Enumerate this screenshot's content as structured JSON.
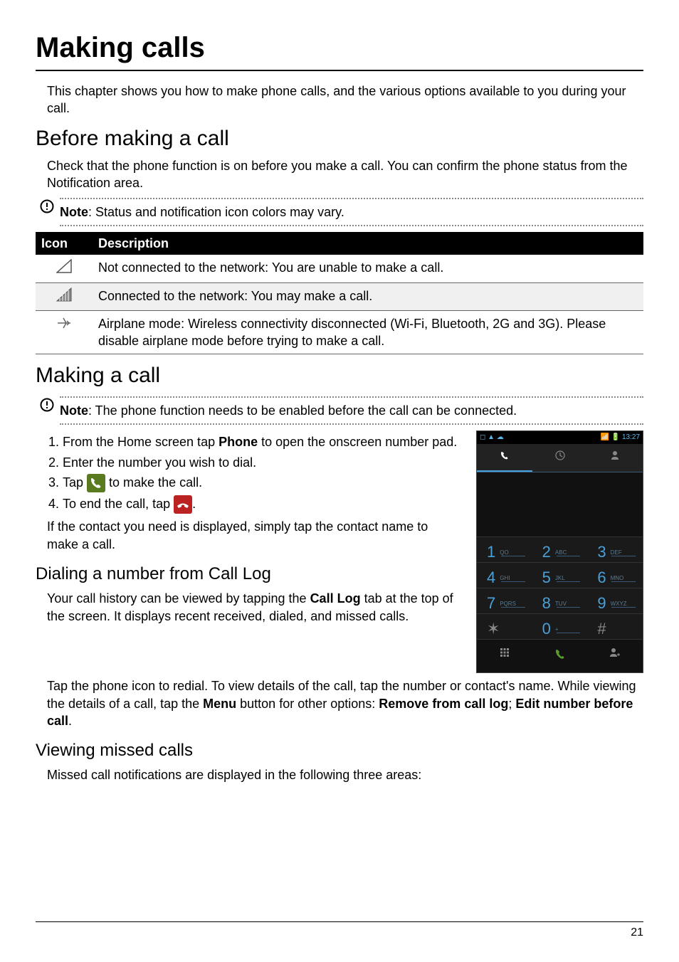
{
  "page": {
    "title": "Making calls",
    "intro": "This chapter shows you how to make phone calls, and the various options available to you during your call.",
    "number": "21"
  },
  "before": {
    "heading": "Before making a call",
    "text": "Check that the phone function is on before you make a call. You can confirm the phone status from the Notification area.",
    "note_label": "Note",
    "note_text": ": Status and notification icon colors may vary."
  },
  "table": {
    "col_icon": "Icon",
    "col_desc": "Description",
    "rows": [
      {
        "desc": "Not connected to the network: You are unable to make a call."
      },
      {
        "desc": "Connected to the network: You may make a call."
      },
      {
        "desc": "Airplane mode: Wireless connectivity disconnected (Wi-Fi, Bluetooth, 2G and 3G). Please disable airplane mode before trying to make a call."
      }
    ]
  },
  "making": {
    "heading": "Making a call",
    "note_label": "Note",
    "note_text": ": The phone function needs to be enabled before the call can be connected.",
    "step1_a": "From the Home screen tap ",
    "step1_b": "Phone",
    "step1_c": " to open the onscreen number pad.",
    "step2": "Enter the number you wish to dial.",
    "step3_a": "Tap ",
    "step3_b": " to make the call.",
    "step4_a": "To end the call, tap ",
    "step4_b": ".",
    "contact_text": "If the contact you need is displayed, simply tap the contact name to make a call."
  },
  "dialing": {
    "heading": "Dialing a number from Call Log",
    "p1_a": "Your call history can be viewed by tapping the ",
    "p1_b": "Call Log",
    "p1_c": " tab at the top of the screen. It displays recent received, dialed, and missed calls.",
    "p2_a": "Tap the phone icon to redial. To view details of the call, tap the number or contact's name. While viewing the details of a call, tap the ",
    "p2_b": "Menu",
    "p2_c": " button for other options: ",
    "p2_d": "Remove from call log",
    "p2_e": "; ",
    "p2_f": "Edit number before call",
    "p2_g": "."
  },
  "missed": {
    "heading": "Viewing missed calls",
    "text": "Missed call notifications are displayed in the following three areas:"
  },
  "phone": {
    "status_left": "◻ ▲ ☁",
    "status_right": "📶 🔋 13:27",
    "keys": [
      {
        "n": "1",
        "l": "QO"
      },
      {
        "n": "2",
        "l": "ABC"
      },
      {
        "n": "3",
        "l": "DEF"
      },
      {
        "n": "4",
        "l": "GHI"
      },
      {
        "n": "5",
        "l": "JKL"
      },
      {
        "n": "6",
        "l": "MNO"
      },
      {
        "n": "7",
        "l": "PQRS"
      },
      {
        "n": "8",
        "l": "TUV"
      },
      {
        "n": "9",
        "l": "WXYZ"
      },
      {
        "n": "✶",
        "l": ""
      },
      {
        "n": "0",
        "l": "+"
      },
      {
        "n": "#",
        "l": ""
      }
    ]
  }
}
